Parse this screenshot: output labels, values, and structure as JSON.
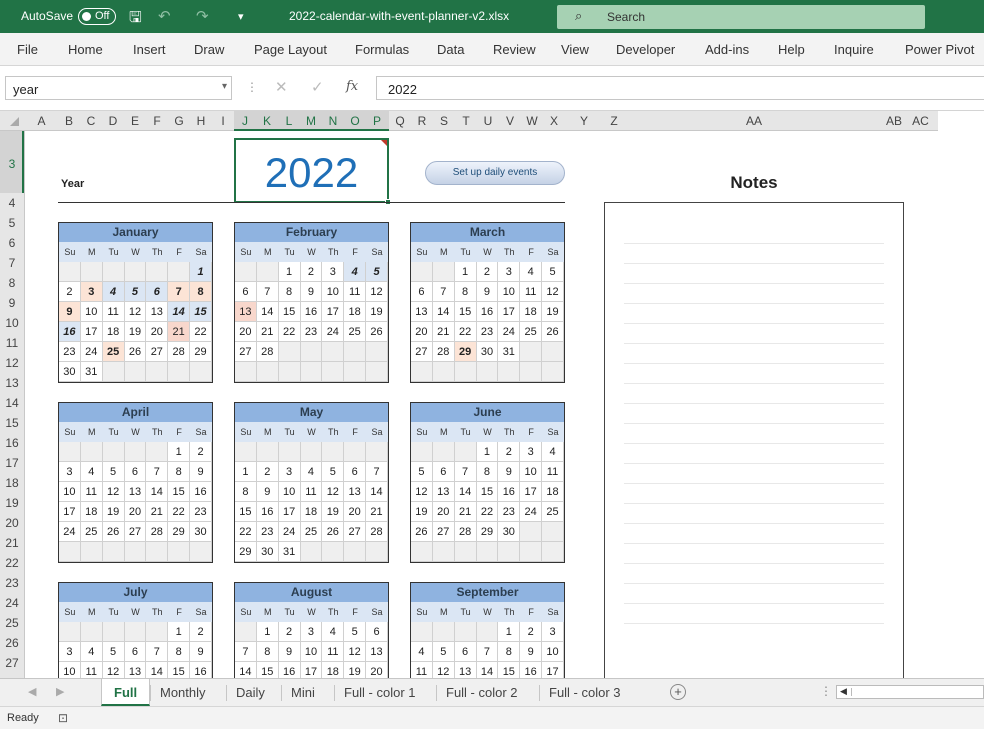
{
  "title_bar": {
    "autosave_label": "AutoSave",
    "autosave_state": "Off",
    "filename": "2022-calendar-with-event-planner-v2.xlsx",
    "search_placeholder": "Search"
  },
  "menu": [
    "File",
    "Home",
    "Insert",
    "Draw",
    "Page Layout",
    "Formulas",
    "Data",
    "Review",
    "View",
    "Developer",
    "Add-ins",
    "Help",
    "Inquire",
    "Power Pivot"
  ],
  "formula_bar": {
    "name_box": "year",
    "cancel": "✕",
    "enter": "✓",
    "fx": "fx",
    "value": "2022"
  },
  "columns": [
    "A",
    "B",
    "C",
    "D",
    "E",
    "F",
    "G",
    "H",
    "I",
    "J",
    "K",
    "L",
    "M",
    "N",
    "O",
    "P",
    "Q",
    "R",
    "S",
    "T",
    "U",
    "V",
    "W",
    "X",
    "Y",
    "Z",
    "AA",
    "AB",
    "AC"
  ],
  "rows": [
    "3",
    "4",
    "5",
    "6",
    "7",
    "8",
    "9",
    "10",
    "11",
    "12",
    "13",
    "14",
    "15",
    "16",
    "17",
    "18",
    "19",
    "20",
    "21",
    "22",
    "23",
    "24",
    "25",
    "26",
    "27"
  ],
  "sheet": {
    "year_label": "Year",
    "year_value": "2022",
    "setup_button": "Set up daily events",
    "notes_title": "Notes"
  },
  "weekday_headers": [
    "Su",
    "M",
    "Tu",
    "W",
    "Th",
    "F",
    "Sa"
  ],
  "months": [
    {
      "name": "January",
      "weeks": [
        [
          "",
          "",
          "",
          "",
          "",
          "",
          "1"
        ],
        [
          "2",
          "3",
          "4",
          "5",
          "6",
          "7",
          "8"
        ],
        [
          "9",
          "10",
          "11",
          "12",
          "13",
          "14",
          "15"
        ],
        [
          "16",
          "17",
          "18",
          "19",
          "20",
          "21",
          "22"
        ],
        [
          "23",
          "24",
          "25",
          "26",
          "27",
          "28",
          "29"
        ],
        [
          "30",
          "31",
          "",
          "",
          "",
          "",
          ""
        ]
      ]
    },
    {
      "name": "February",
      "weeks": [
        [
          "",
          "",
          "1",
          "2",
          "3",
          "4",
          "5"
        ],
        [
          "6",
          "7",
          "8",
          "9",
          "10",
          "11",
          "12"
        ],
        [
          "13",
          "14",
          "15",
          "16",
          "17",
          "18",
          "19"
        ],
        [
          "20",
          "21",
          "22",
          "23",
          "24",
          "25",
          "26"
        ],
        [
          "27",
          "28",
          "",
          "",
          "",
          "",
          ""
        ],
        [
          "",
          "",
          "",
          "",
          "",
          "",
          ""
        ]
      ]
    },
    {
      "name": "March",
      "weeks": [
        [
          "",
          "",
          "1",
          "2",
          "3",
          "4",
          "5"
        ],
        [
          "6",
          "7",
          "8",
          "9",
          "10",
          "11",
          "12"
        ],
        [
          "13",
          "14",
          "15",
          "16",
          "17",
          "18",
          "19"
        ],
        [
          "20",
          "21",
          "22",
          "23",
          "24",
          "25",
          "26"
        ],
        [
          "27",
          "28",
          "29",
          "30",
          "31",
          "",
          ""
        ],
        [
          "",
          "",
          "",
          "",
          "",
          "",
          ""
        ]
      ]
    },
    {
      "name": "April",
      "weeks": [
        [
          "",
          "",
          "",
          "",
          "",
          "1",
          "2"
        ],
        [
          "3",
          "4",
          "5",
          "6",
          "7",
          "8",
          "9"
        ],
        [
          "10",
          "11",
          "12",
          "13",
          "14",
          "15",
          "16"
        ],
        [
          "17",
          "18",
          "19",
          "20",
          "21",
          "22",
          "23"
        ],
        [
          "24",
          "25",
          "26",
          "27",
          "28",
          "29",
          "30"
        ],
        [
          "",
          "",
          "",
          "",
          "",
          "",
          ""
        ]
      ]
    },
    {
      "name": "May",
      "weeks": [
        [
          "",
          "",
          "",
          "",
          "",
          "",
          ""
        ],
        [
          "1",
          "2",
          "3",
          "4",
          "5",
          "6",
          "7"
        ],
        [
          "8",
          "9",
          "10",
          "11",
          "12",
          "13",
          "14"
        ],
        [
          "15",
          "16",
          "17",
          "18",
          "19",
          "20",
          "21"
        ],
        [
          "22",
          "23",
          "24",
          "25",
          "26",
          "27",
          "28"
        ],
        [
          "29",
          "30",
          "31",
          "",
          "",
          "",
          ""
        ]
      ]
    },
    {
      "name": "June",
      "weeks": [
        [
          "",
          "",
          "",
          "1",
          "2",
          "3",
          "4"
        ],
        [
          "5",
          "6",
          "7",
          "8",
          "9",
          "10",
          "11"
        ],
        [
          "12",
          "13",
          "14",
          "15",
          "16",
          "17",
          "18"
        ],
        [
          "19",
          "20",
          "21",
          "22",
          "23",
          "24",
          "25"
        ],
        [
          "26",
          "27",
          "28",
          "29",
          "30",
          "",
          ""
        ],
        [
          "",
          "",
          "",
          "",
          "",
          "",
          ""
        ]
      ]
    },
    {
      "name": "July",
      "weeks": [
        [
          "",
          "",
          "",
          "",
          "",
          "1",
          "2"
        ],
        [
          "3",
          "4",
          "5",
          "6",
          "7",
          "8",
          "9"
        ],
        [
          "10",
          "11",
          "12",
          "13",
          "14",
          "15",
          "16"
        ]
      ]
    },
    {
      "name": "August",
      "weeks": [
        [
          "",
          "1",
          "2",
          "3",
          "4",
          "5",
          "6"
        ],
        [
          "7",
          "8",
          "9",
          "10",
          "11",
          "12",
          "13"
        ],
        [
          "14",
          "15",
          "16",
          "17",
          "18",
          "19",
          "20"
        ]
      ]
    },
    {
      "name": "September",
      "weeks": [
        [
          "",
          "",
          "",
          "",
          "1",
          "2",
          "3"
        ],
        [
          "4",
          "5",
          "6",
          "7",
          "8",
          "9",
          "10"
        ],
        [
          "11",
          "12",
          "13",
          "14",
          "15",
          "16",
          "17"
        ]
      ]
    }
  ],
  "highlights": {
    "January": {
      "blue": [
        "1",
        "4",
        "5",
        "6",
        "14",
        "15",
        "16"
      ],
      "event": [
        "3",
        "7",
        "8",
        "9",
        "25"
      ],
      "event_light": [
        "21"
      ]
    },
    "February": {
      "blue": [
        "4",
        "5"
      ],
      "event": [],
      "event_light": [
        "13"
      ]
    },
    "March": {
      "blue": [],
      "event": [
        "29"
      ],
      "event_light": []
    }
  },
  "sheet_tabs": [
    "Full",
    "Monthly",
    "Daily",
    "Mini",
    "Full - color 1",
    "Full - color 2",
    "Full - color 3"
  ],
  "active_tab": "Full",
  "status": {
    "ready": "Ready"
  }
}
